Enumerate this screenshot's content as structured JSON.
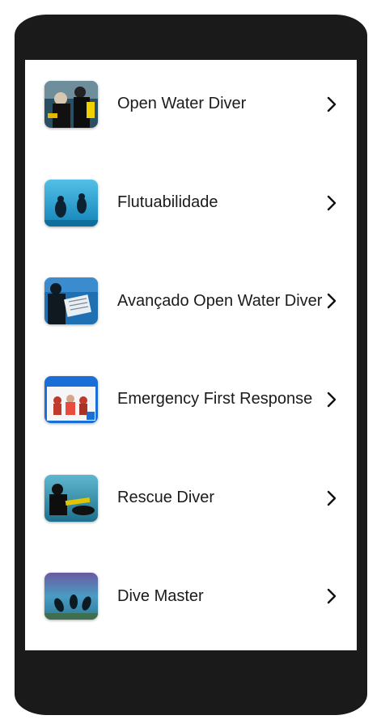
{
  "courses": [
    {
      "label": "Open Water Diver",
      "thumb_icon": "open-water-thumbnail",
      "accent": "#2f6f8f"
    },
    {
      "label": "Flutuabilidade",
      "thumb_icon": "buoyancy-thumbnail",
      "accent": "#1f9fcf"
    },
    {
      "label": "Avançado Open Water Diver",
      "thumb_icon": "advanced-thumbnail",
      "accent": "#1e5fa8"
    },
    {
      "label": "Emergency First Response",
      "thumb_icon": "efr-thumbnail",
      "accent": "#1a73d9"
    },
    {
      "label": "Rescue Diver",
      "thumb_icon": "rescue-thumbnail",
      "accent": "#2a8aa8"
    },
    {
      "label": "Dive Master",
      "thumb_icon": "divemaster-thumbnail",
      "accent": "#3b90b8"
    }
  ],
  "chevron_icon": "chevron-right-icon"
}
